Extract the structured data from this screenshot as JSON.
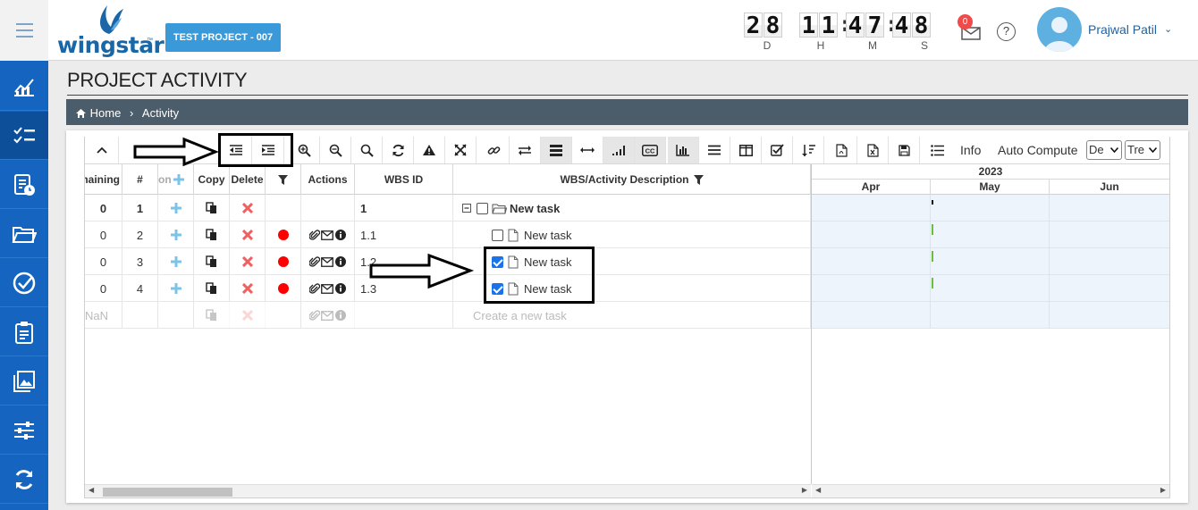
{
  "header": {
    "logo_text": "wingstar",
    "logo_tm": "™",
    "project_button": "TEST PROJECT - 007",
    "countdown": {
      "days": [
        "2",
        "8"
      ],
      "hours": [
        "1",
        "1"
      ],
      "minutes": [
        "4",
        "7"
      ],
      "seconds": [
        "4",
        "8"
      ],
      "labels": {
        "d": "D",
        "h": "H",
        "m": "M",
        "s": "S"
      }
    },
    "mail_badge": "0",
    "help": "?",
    "user_name": "Prajwal Patil"
  },
  "sidebar": {
    "items": [
      {
        "icon": "chart-icon"
      },
      {
        "icon": "checklist-icon",
        "active": true
      },
      {
        "icon": "document-clock-icon"
      },
      {
        "icon": "folder-icon"
      },
      {
        "icon": "check-circle-icon"
      },
      {
        "icon": "clipboard-icon"
      },
      {
        "icon": "gallery-icon"
      },
      {
        "icon": "sliders-icon"
      },
      {
        "icon": "sync-icon"
      }
    ]
  },
  "page": {
    "title": "PROJECT ACTIVITY",
    "breadcrumb_home": "Home",
    "breadcrumb_sep": "›",
    "breadcrumb_current": "Activity"
  },
  "toolbar": {
    "info": "Info",
    "auto_compute": "Auto Compute",
    "select1": "De",
    "select2": "Tre"
  },
  "grid": {
    "columns": [
      "maining",
      "#",
      "on",
      "Copy",
      "Delete",
      "",
      "Actions",
      "WBS ID",
      "WBS/Activity Description"
    ],
    "rows": [
      {
        "remaining": "0",
        "num": "1",
        "wbs": "1",
        "desc": "New task",
        "dot": false,
        "actions": false,
        "folder": true,
        "checked": false
      },
      {
        "remaining": "0",
        "num": "2",
        "wbs": "1.1",
        "desc": "New task",
        "dot": true,
        "actions": true,
        "folder": false,
        "checked": false
      },
      {
        "remaining": "0",
        "num": "3",
        "wbs": "1.2",
        "desc": "New task",
        "dot": true,
        "actions": true,
        "folder": false,
        "checked": true
      },
      {
        "remaining": "0",
        "num": "4",
        "wbs": "1.3",
        "desc": "New task",
        "dot": true,
        "actions": true,
        "folder": false,
        "checked": true
      }
    ],
    "new_row": {
      "remaining": "NaN",
      "placeholder": "Create a new task"
    }
  },
  "gantt": {
    "year": "2023",
    "months": [
      "Apr",
      "May",
      "Jun"
    ]
  },
  "colors": {
    "sidebar": "#1565c0",
    "accent": "#3a9ad9",
    "breadcrumb": "#4b5d6b",
    "delete": "#f06060",
    "status_dot": "#ff0000",
    "add": "#7cc3e8"
  }
}
